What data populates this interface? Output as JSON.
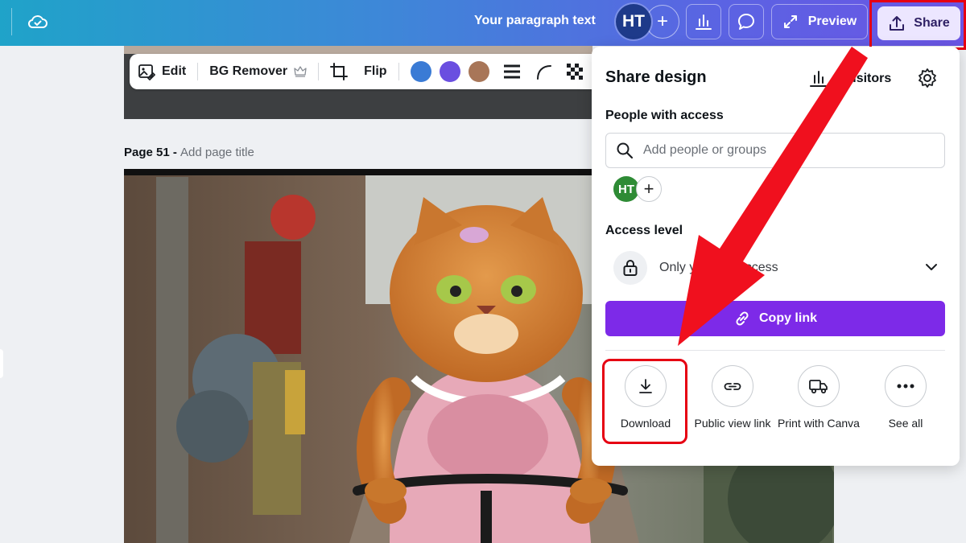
{
  "topbar": {
    "doc_title": "Your paragraph text",
    "avatar_initials": "HT",
    "add_label": "+",
    "preview_label": "Preview",
    "share_label": "Share"
  },
  "context_toolbar": {
    "edit_label": "Edit",
    "bg_remover_label": "BG Remover",
    "flip_label": "Flip",
    "swatches": [
      "#3a7bd5",
      "#6a4fe0",
      "#a87658"
    ]
  },
  "page": {
    "number_label": "Page 51 - ",
    "add_title_label": "Add page title"
  },
  "share_panel": {
    "title": "Share design",
    "visitors_label": "0 visitors",
    "people_with_access_label": "People with access",
    "search_placeholder": "Add people or groups",
    "member_initials": "HT",
    "access_level_label": "Access level",
    "access_level_value": "Only you can access",
    "copy_link_label": "Copy link",
    "options": [
      {
        "label": "Download",
        "icon": "download-icon"
      },
      {
        "label": "Public view link",
        "icon": "link-icon"
      },
      {
        "label": "Print with Canva",
        "icon": "truck-icon"
      },
      {
        "label": "See all",
        "icon": "more-icon"
      }
    ]
  },
  "colors": {
    "accent_purple": "#7d2ae8",
    "highlight_red": "#e60012"
  }
}
